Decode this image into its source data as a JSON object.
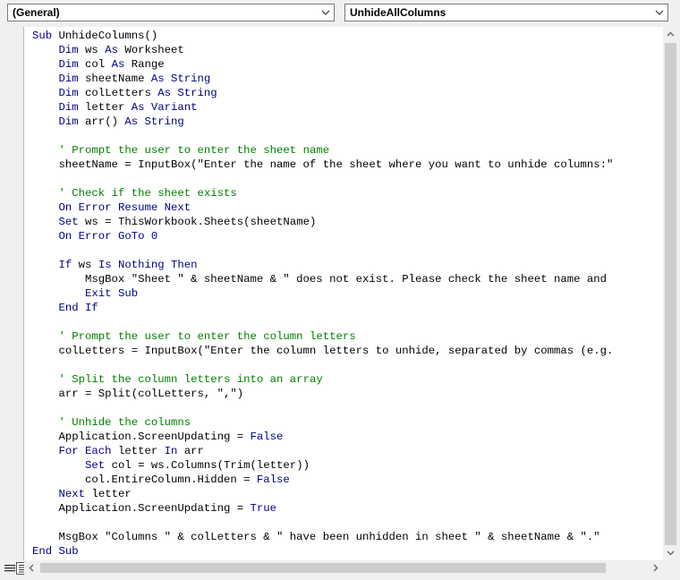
{
  "toolbar": {
    "object_dropdown": "(General)",
    "procedure_dropdown": "UnhideAllColumns"
  },
  "code": {
    "lines": [
      [
        {
          "t": "Sub ",
          "k": 1
        },
        {
          "t": "UnhideColumns()"
        }
      ],
      [
        {
          "t": "    "
        },
        {
          "t": "Dim",
          "k": 1
        },
        {
          "t": " ws "
        },
        {
          "t": "As",
          "k": 1
        },
        {
          "t": " Worksheet"
        }
      ],
      [
        {
          "t": "    "
        },
        {
          "t": "Dim",
          "k": 1
        },
        {
          "t": " col "
        },
        {
          "t": "As",
          "k": 1
        },
        {
          "t": " Range"
        }
      ],
      [
        {
          "t": "    "
        },
        {
          "t": "Dim",
          "k": 1
        },
        {
          "t": " sheetName "
        },
        {
          "t": "As",
          "k": 1
        },
        {
          "t": " "
        },
        {
          "t": "String",
          "k": 1
        }
      ],
      [
        {
          "t": "    "
        },
        {
          "t": "Dim",
          "k": 1
        },
        {
          "t": " colLetters "
        },
        {
          "t": "As",
          "k": 1
        },
        {
          "t": " "
        },
        {
          "t": "String",
          "k": 1
        }
      ],
      [
        {
          "t": "    "
        },
        {
          "t": "Dim",
          "k": 1
        },
        {
          "t": " letter "
        },
        {
          "t": "As",
          "k": 1
        },
        {
          "t": " "
        },
        {
          "t": "Variant",
          "k": 1
        }
      ],
      [
        {
          "t": "    "
        },
        {
          "t": "Dim",
          "k": 1
        },
        {
          "t": " arr() "
        },
        {
          "t": "As",
          "k": 1
        },
        {
          "t": " "
        },
        {
          "t": "String",
          "k": 1
        }
      ],
      [],
      [
        {
          "t": "    "
        },
        {
          "t": "' Prompt the user to enter the sheet name",
          "c": 1
        }
      ],
      [
        {
          "t": "    sheetName = InputBox(\"Enter the name of the sheet where you want to unhide columns:\""
        }
      ],
      [],
      [
        {
          "t": "    "
        },
        {
          "t": "' Check if the sheet exists",
          "c": 1
        }
      ],
      [
        {
          "t": "    "
        },
        {
          "t": "On Error Resume Next",
          "k": 1
        }
      ],
      [
        {
          "t": "    "
        },
        {
          "t": "Set",
          "k": 1
        },
        {
          "t": " ws = ThisWorkbook.Sheets(sheetName)"
        }
      ],
      [
        {
          "t": "    "
        },
        {
          "t": "On Error GoTo 0",
          "k": 1
        }
      ],
      [],
      [
        {
          "t": "    "
        },
        {
          "t": "If",
          "k": 1
        },
        {
          "t": " ws "
        },
        {
          "t": "Is Nothing Then",
          "k": 1
        }
      ],
      [
        {
          "t": "        MsgBox \"Sheet \" & sheetName & \" does not exist. Please check the sheet name and"
        }
      ],
      [
        {
          "t": "        "
        },
        {
          "t": "Exit Sub",
          "k": 1
        }
      ],
      [
        {
          "t": "    "
        },
        {
          "t": "End If",
          "k": 1
        }
      ],
      [],
      [
        {
          "t": "    "
        },
        {
          "t": "' Prompt the user to enter the column letters",
          "c": 1
        }
      ],
      [
        {
          "t": "    colLetters = InputBox(\"Enter the column letters to unhide, separated by commas (e.g."
        }
      ],
      [],
      [
        {
          "t": "    "
        },
        {
          "t": "' Split the column letters into an array",
          "c": 1
        }
      ],
      [
        {
          "t": "    arr = Split(colLetters, \",\")"
        }
      ],
      [],
      [
        {
          "t": "    "
        },
        {
          "t": "' Unhide the columns",
          "c": 1
        }
      ],
      [
        {
          "t": "    Application.ScreenUpdating = "
        },
        {
          "t": "False",
          "k": 1
        }
      ],
      [
        {
          "t": "    "
        },
        {
          "t": "For Each",
          "k": 1
        },
        {
          "t": " letter "
        },
        {
          "t": "In",
          "k": 1
        },
        {
          "t": " arr"
        }
      ],
      [
        {
          "t": "        "
        },
        {
          "t": "Set",
          "k": 1
        },
        {
          "t": " col = ws.Columns(Trim(letter))"
        }
      ],
      [
        {
          "t": "        col.EntireColumn.Hidden = "
        },
        {
          "t": "False",
          "k": 1
        }
      ],
      [
        {
          "t": "    "
        },
        {
          "t": "Next",
          "k": 1
        },
        {
          "t": " letter"
        }
      ],
      [
        {
          "t": "    Application.ScreenUpdating = "
        },
        {
          "t": "True",
          "k": 1
        }
      ],
      [],
      [
        {
          "t": "    MsgBox \"Columns \" & colLetters & \" have been unhidden in sheet \" & sheetName & \".\""
        }
      ],
      [
        {
          "t": "End Sub",
          "k": 1
        }
      ]
    ]
  },
  "icons": {
    "dropdown_arrow": "chevron-down-icon",
    "procedure_view": "procedure-view-icon",
    "module_view": "full-module-view-icon"
  },
  "colors": {
    "keyword": "#00008b",
    "comment": "#008000",
    "text": "#000000"
  }
}
